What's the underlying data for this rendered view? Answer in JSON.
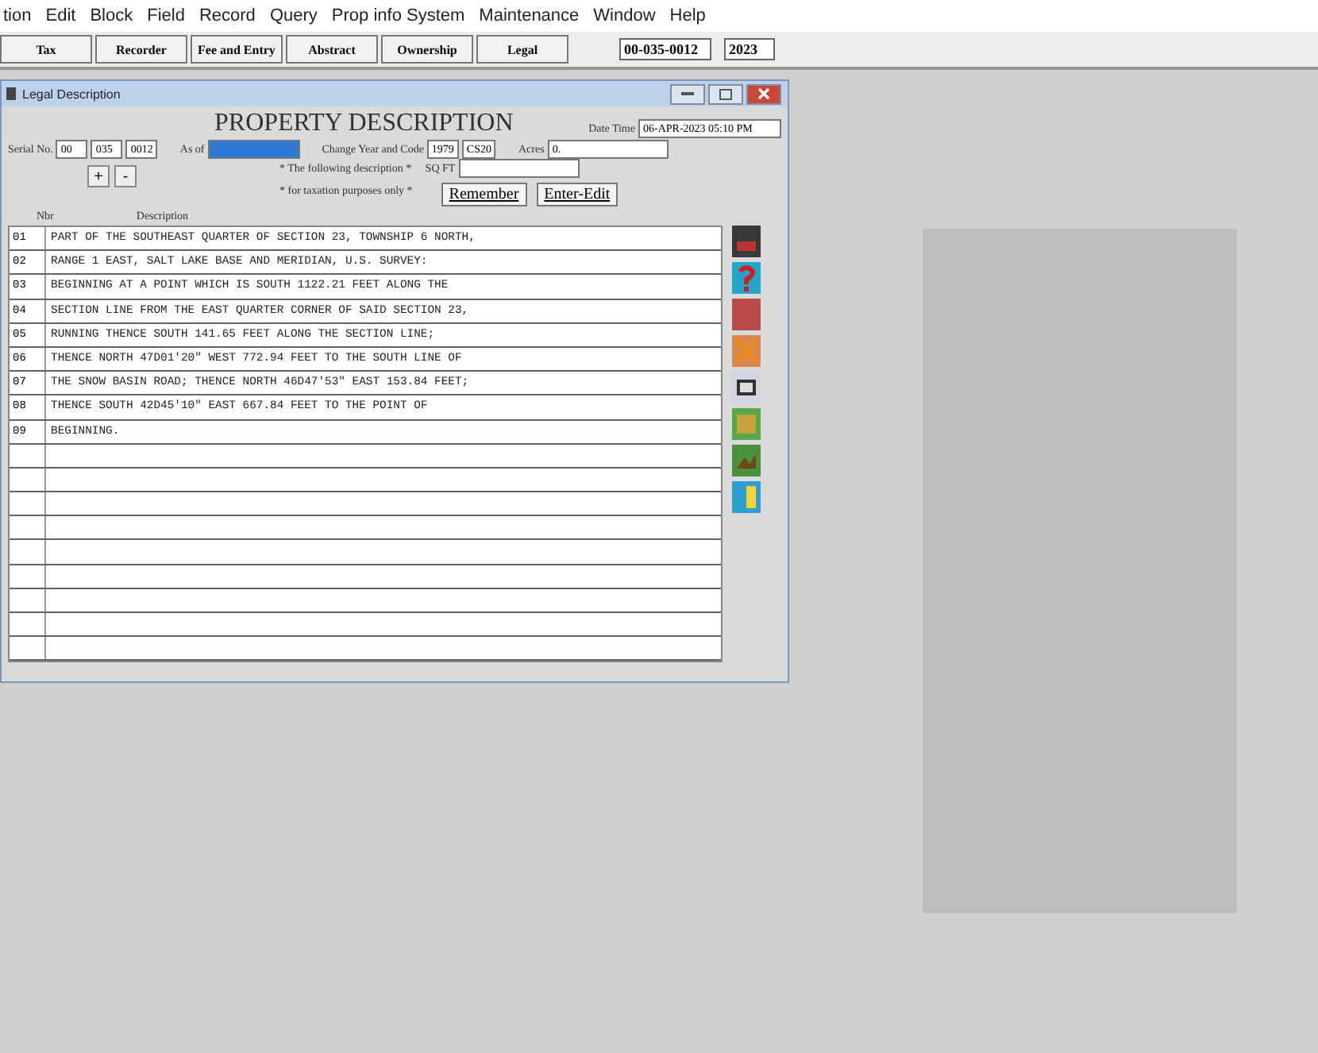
{
  "menu": [
    "tion",
    "Edit",
    "Block",
    "Field",
    "Record",
    "Query",
    "Prop info System",
    "Maintenance",
    "Window",
    "Help"
  ],
  "toolbar": {
    "buttons": [
      "Tax",
      "Recorder",
      "Fee and Entry",
      "Abstract",
      "Ownership",
      "Legal"
    ],
    "parcel": "00-035-0012",
    "year": "2023"
  },
  "window": {
    "title": "Legal Description",
    "heading": "PROPERTY DESCRIPTION",
    "date_label": "Date Time",
    "date": "06-APR-2023 05:10 PM",
    "serial_label": "Serial No.",
    "serial": [
      "00",
      "035",
      "0012"
    ],
    "as_of_label": "As of",
    "as_of_selected": true,
    "change_label": "Change Year and Code",
    "change_year": "1979",
    "change_code": "CS20",
    "acres_label": "Acres",
    "acres": "0.",
    "note1": "* The following description *",
    "sqft_label": "SQ FT",
    "note2": "* for taxation purposes only *",
    "plus": "+",
    "minus": "-",
    "buttons": [
      "Remember",
      "Enter-Edit"
    ],
    "columns": [
      "Nbr",
      "Description"
    ],
    "rows": [
      {
        "nbr": "01",
        "text": "PART OF THE SOUTHEAST QUARTER OF SECTION 23, TOWNSHIP 6 NORTH,"
      },
      {
        "nbr": "02",
        "text": "RANGE 1 EAST, SALT LAKE BASE AND MERIDIAN, U.S. SURVEY:"
      },
      {
        "nbr": "03",
        "text": "BEGINNING AT A POINT WHICH IS SOUTH 1122.21 FEET ALONG THE"
      },
      {
        "nbr": "04",
        "text": "SECTION LINE FROM THE EAST QUARTER CORNER OF SAID SECTION 23,"
      },
      {
        "nbr": "05",
        "text": "RUNNING THENCE SOUTH 141.65 FEET ALONG THE SECTION LINE;"
      },
      {
        "nbr": "06",
        "text": "THENCE NORTH 47D01'20\" WEST 772.94 FEET TO THE SOUTH LINE OF"
      },
      {
        "nbr": "07",
        "text": "THE SNOW BASIN ROAD; THENCE NORTH 46D47'53\" EAST 153.84 FEET;"
      },
      {
        "nbr": "08",
        "text": "THENCE SOUTH 42D45'10\" EAST 667.84 FEET TO THE POINT OF"
      },
      {
        "nbr": "09",
        "text": "BEGINNING."
      }
    ]
  }
}
